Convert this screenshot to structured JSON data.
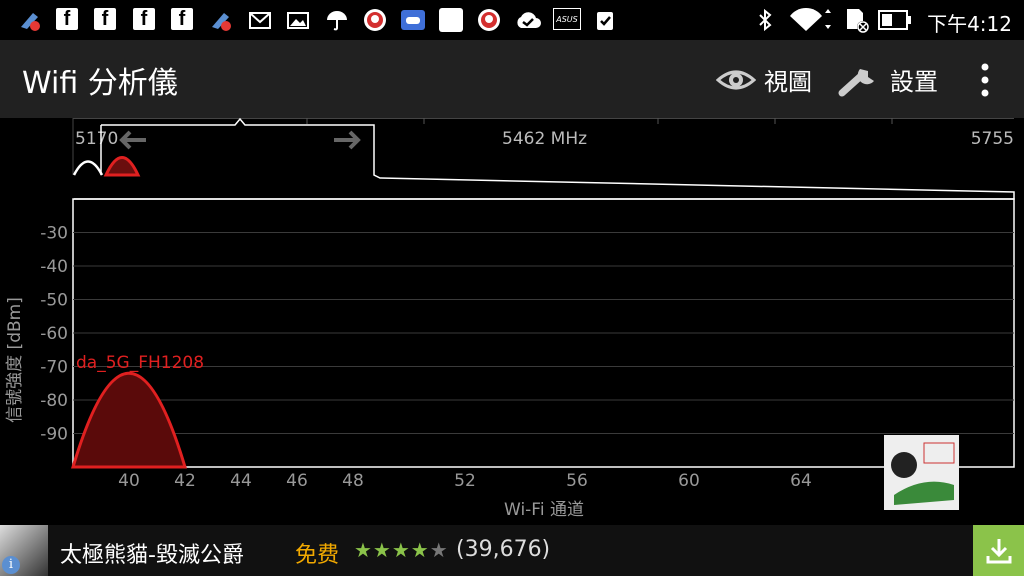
{
  "status_bar": {
    "time": "下午4:12",
    "icons": [
      "usb-clean-icon",
      "facebook-icon",
      "facebook-icon",
      "facebook-icon",
      "facebook-icon",
      "usb-clean-icon",
      "mail-icon",
      "image-icon",
      "umbrella-icon",
      "app-icon",
      "game-icon",
      "blank-icon",
      "app-icon",
      "cloud-check-icon",
      "asus-icon",
      "clipboard-check-icon",
      "bluetooth-icon",
      "wifi-icon",
      "sd-card-icon",
      "battery-icon"
    ],
    "asus_label": "ASUS"
  },
  "app_bar": {
    "title": "Wifi 分析儀",
    "view_label": "視圖",
    "settings_label": "設置"
  },
  "overview": {
    "left_label": "5170",
    "center_label": "5462 MHz",
    "right_label": "5755"
  },
  "chart_data": {
    "type": "area",
    "xlabel": "Wi-Fi 通道",
    "ylabel": "信號強度 [dBm]",
    "x_ticks": [
      40,
      42,
      44,
      46,
      48,
      52,
      56,
      60,
      64
    ],
    "y_ticks": [
      -30,
      -40,
      -50,
      -60,
      -70,
      -80,
      -90
    ],
    "ylim": [
      -100,
      -20
    ],
    "grid": true,
    "series": [
      {
        "name": "da_5G_FH1208",
        "channel": 40,
        "peak_dbm": -72,
        "color": "#e02020"
      }
    ]
  },
  "ad": {
    "title": "太極熊貓-毀滅公爵",
    "price": "免费",
    "stars_on": "★★★★",
    "stars_off": "★",
    "rating_count": "(39,676)",
    "info_badge": "i"
  },
  "colors": {
    "appbar_bg": "#212121",
    "signal_red": "#e02020",
    "download_green": "#8bc34a",
    "price_orange": "#f2a900"
  }
}
